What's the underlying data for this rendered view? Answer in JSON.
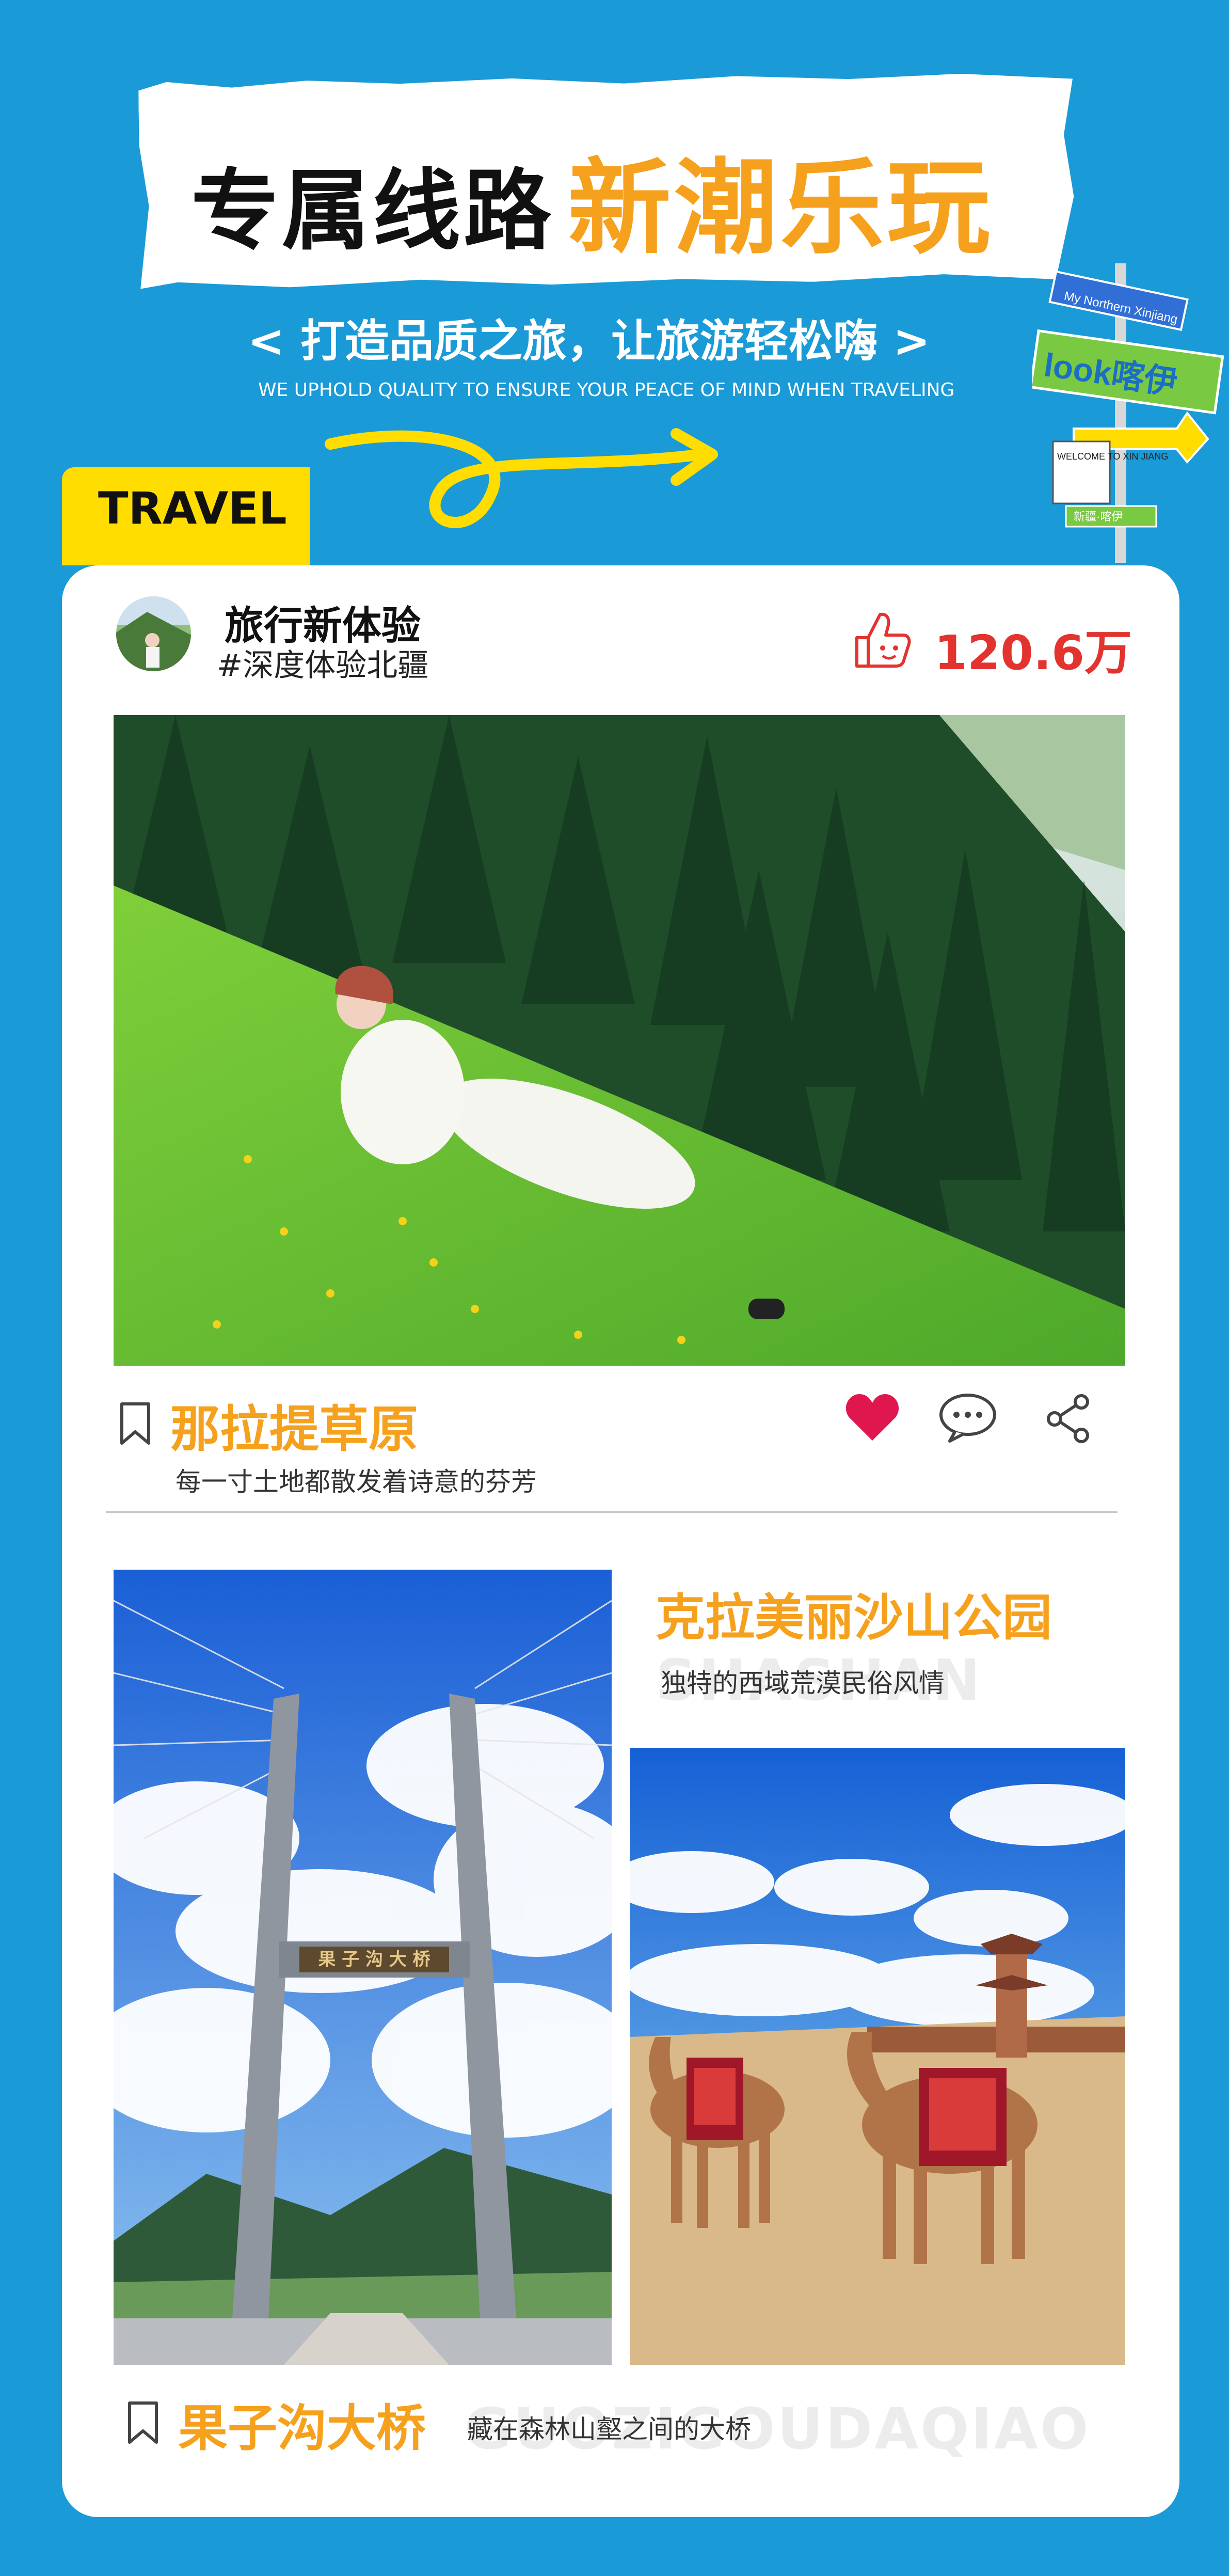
{
  "header": {
    "title_black": "专属线路",
    "title_orange": "新潮乐玩",
    "slogan": "< 打造品质之旅，让旅游轻松嗨 >",
    "slogan_en": "WE UPHOLD QUALITY TO ENSURE YOUR PEACE OF MIND WHEN TRAVELING"
  },
  "signpost": {
    "board1": "My Northern Xinjiang",
    "board2": "look喀伊",
    "board3": "WELCOME TO XIN JIANG",
    "board4": "新疆·喀伊"
  },
  "travel_tab": {
    "label": "TRAVEL"
  },
  "profile": {
    "name": "旅行新体验",
    "hashtag": "#深度体验北疆",
    "like_count": "120.6万"
  },
  "spots": [
    {
      "title": "那拉提草原",
      "desc": "每一寸土地都散发着诗意的芬芳"
    },
    {
      "title": "克拉美丽沙山公园",
      "desc": "独特的西域荒漠民俗风情",
      "watermark": "SHASHAN"
    },
    {
      "title": "果子沟大桥",
      "desc": "藏在森林山壑之间的大桥",
      "watermark": "GUOZIGOUDAQIAO",
      "bridge_sign": "果 子 沟 大 桥"
    }
  ],
  "icons": {
    "bookmark": "bookmark-icon",
    "heart": "heart-icon",
    "comment": "comment-icon",
    "share": "share-icon",
    "like": "thumbs-up-icon"
  },
  "colors": {
    "background": "#1a9ad6",
    "accent_orange": "#f6a11e",
    "like_red": "#e2332e",
    "tab_yellow": "#ffdd00",
    "sign_green": "#7ac943"
  }
}
